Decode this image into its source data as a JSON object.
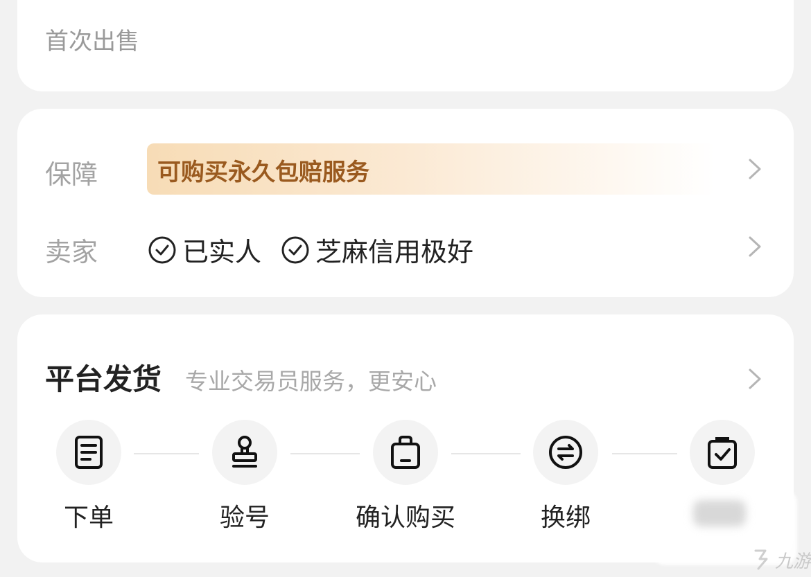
{
  "listing": {
    "first_sale": "首次出售"
  },
  "guarantee": {
    "label": "保障",
    "text": "可购买永久包赔服务",
    "gradient_color": "#f7dcb6",
    "text_color": "#9a5a1f"
  },
  "seller": {
    "label": "卖家",
    "badges": [
      {
        "icon": "check-circle-icon",
        "text": "已实人"
      },
      {
        "icon": "check-circle-icon",
        "text": "芝麻信用极好"
      }
    ]
  },
  "shipping": {
    "title": "平台发货",
    "subtitle": "专业交易员服务，更安心",
    "steps": [
      {
        "icon": "document-icon",
        "label": "下单"
      },
      {
        "icon": "stamp-icon",
        "label": "验号"
      },
      {
        "icon": "shopping-bag-icon",
        "label": "确认购买"
      },
      {
        "icon": "swap-icon",
        "label": "换绑"
      },
      {
        "icon": "checked-box-icon",
        "label": ""
      }
    ]
  },
  "watermark": {
    "text": "九游"
  }
}
